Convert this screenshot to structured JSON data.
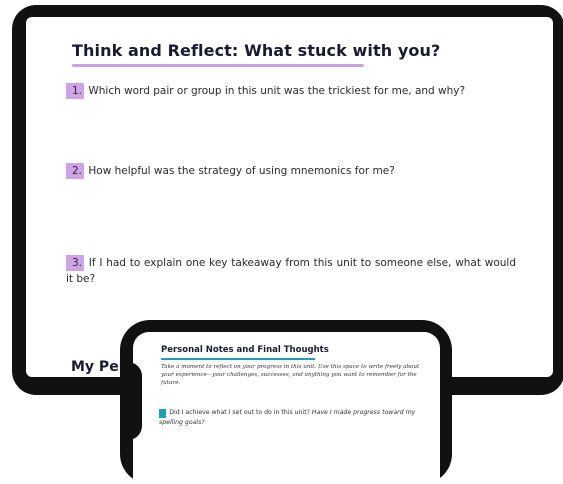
{
  "tablet": {
    "title": "Think and Reflect: What stuck with you?",
    "questions": [
      {
        "number": "1.",
        "text": "Which word pair or group in this unit was the trickiest for me, and why?"
      },
      {
        "number": "2.",
        "text": "How helpful was the strategy of using mnemonics for me?"
      },
      {
        "number": "3.",
        "text": "If I had to explain one key takeaway from this unit to someone else, what would it be?"
      }
    ],
    "next_section_peek": "My Per"
  },
  "phone": {
    "title": "Personal Notes and Final Thoughts",
    "intro": "Take a moment to reflect on your progress in this unit. Use this space to write freely about your experience—your challenges, successes, and anything you want to remember for the future.",
    "questions": [
      {
        "number": "1.",
        "text": "Did I achieve what I set out to do in this unit?",
        "italic": "Have I made progress toward my spelling goals?"
      }
    ]
  },
  "colors": {
    "tablet_accent": "#cfa3e8",
    "phone_accent": "#1d9fb3",
    "device_frame": "#111111"
  }
}
